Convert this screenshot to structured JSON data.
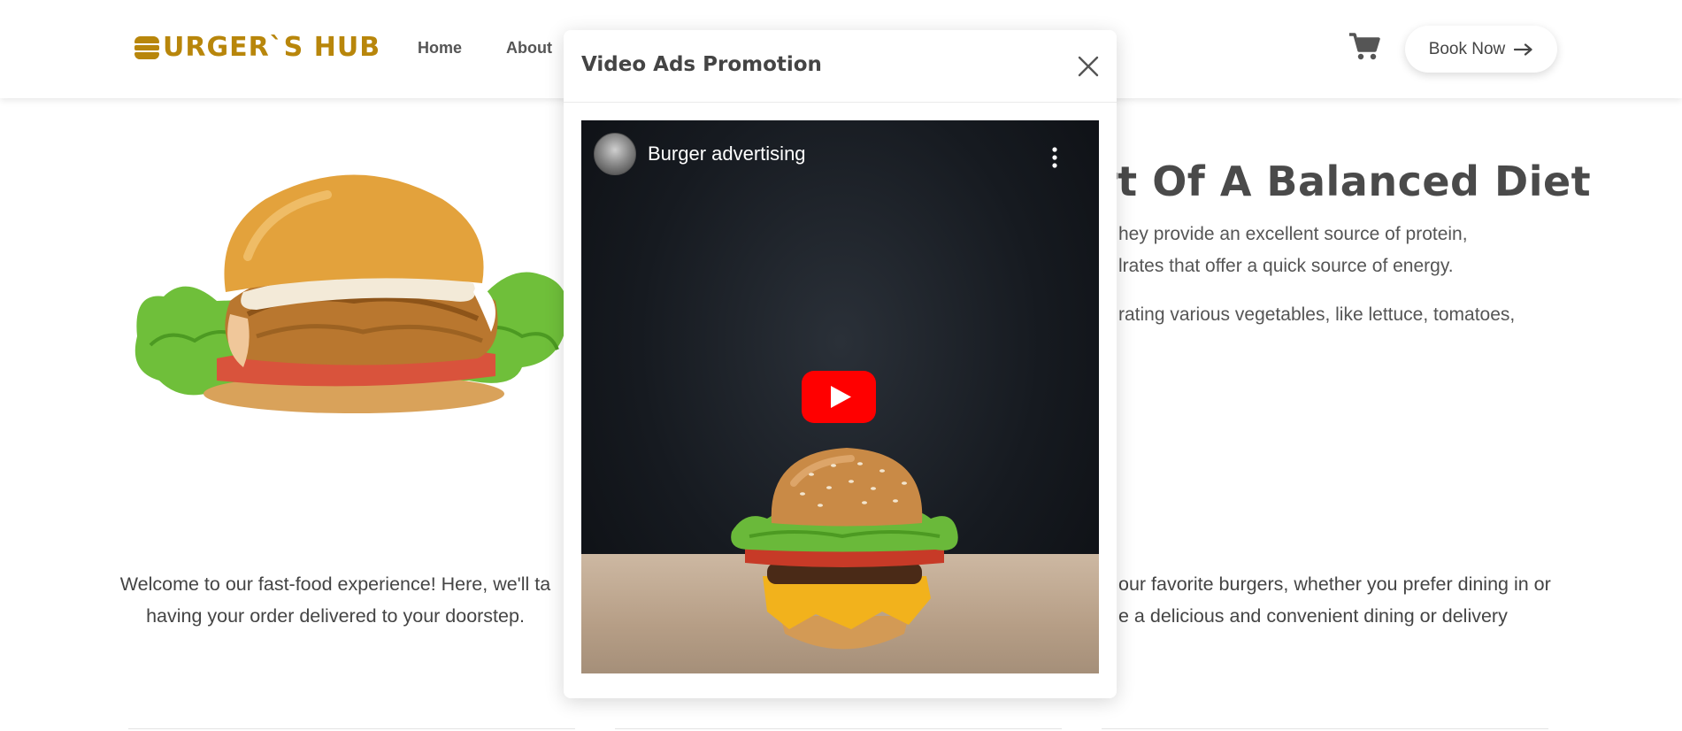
{
  "header": {
    "logo_text": "URGER`S HUB",
    "nav": {
      "home": "Home",
      "about": "About"
    },
    "book_now": "Book Now"
  },
  "main": {
    "heading_partial": "rt Of A Balanced Diet",
    "paragraph_lines": [
      "hey provide an excellent source of protein,",
      "lrates that offer a quick source of energy.",
      "rating various vegetables, like lettuce, tomatoes,"
    ],
    "welcome_left": [
      "Welcome to our fast-food experience! Here, we'll ta",
      "having your order delivered to your doorstep."
    ],
    "welcome_right": [
      "our favorite burgers, whether you prefer dining in or",
      "e a delicious and convenient dining or delivery"
    ]
  },
  "modal": {
    "title": "Video Ads Promotion",
    "video": {
      "title": "Burger advertising"
    }
  },
  "colors": {
    "brand": "#b8860b",
    "text": "#4a4a4a",
    "youtube_red": "#ff0000"
  },
  "icons": [
    "cart-icon",
    "arrow-right-icon",
    "close-icon",
    "play-icon",
    "more-vertical-icon"
  ]
}
